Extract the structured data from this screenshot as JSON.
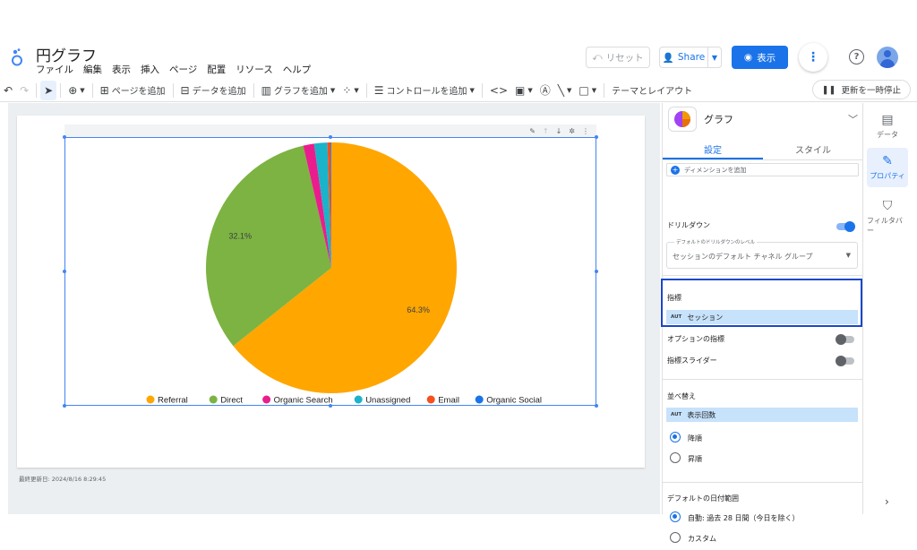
{
  "header": {
    "title": "円グラフ",
    "menu": [
      "ファイル",
      "編集",
      "表示",
      "挿入",
      "ページ",
      "配置",
      "リソース",
      "ヘルプ"
    ],
    "reset_label": "リセット",
    "share_label": "Share",
    "view_label": "表示"
  },
  "toolbar": {
    "add_page": "ページを追加",
    "add_data": "データを追加",
    "add_chart": "グラフを追加",
    "add_control": "コントロールを追加",
    "theme_layout": "テーマとレイアウト",
    "pause_update": "更新を一時停止"
  },
  "canvas": {
    "last_updated": "最終更新日: 2024/8/16 8:29:45"
  },
  "chart_data": {
    "type": "pie",
    "categories": [
      "Referral",
      "Direct",
      "Organic Search",
      "Unassigned",
      "Email",
      "Organic Social"
    ],
    "values": [
      64.3,
      32.1,
      1.4,
      1.7,
      0.4,
      0.1
    ],
    "colors": [
      "#ffa600",
      "#7cb342",
      "#e91e8c",
      "#1bb3c9",
      "#f4511e",
      "#1a73e8"
    ],
    "data_labels": [
      "64.3%",
      "32.1%",
      "",
      "",
      "",
      ""
    ],
    "legend_position": "bottom"
  },
  "panel": {
    "title": "グラフ",
    "tabs": [
      "設定",
      "スタイル"
    ],
    "active_tab": "設定",
    "add_dimension": "ディメンションを追加",
    "drilldown_label": "ドリルダウン",
    "drilldown_on": true,
    "default_drill_level_label": "デフォルトのドリルダウンのレベル",
    "default_drill_level_value": "セッションのデフォルト チャネル グループ",
    "metric_label": "指標",
    "metric_chip": "セッション",
    "chip_type": "AUT",
    "optional_metrics_label": "オプションの指標",
    "metric_slider_label": "指標スライダー",
    "sort_label": "並べ替え",
    "sort_chip": "表示回数",
    "sort_desc": "降順",
    "sort_asc": "昇順",
    "date_range_label": "デフォルトの日付範囲",
    "date_auto": "自動: 過去 28 日間（今日を除く）",
    "date_custom": "カスタム"
  },
  "rail": {
    "data": "データ",
    "properties": "プロパティ",
    "filter_bar": "フィルタバー"
  }
}
